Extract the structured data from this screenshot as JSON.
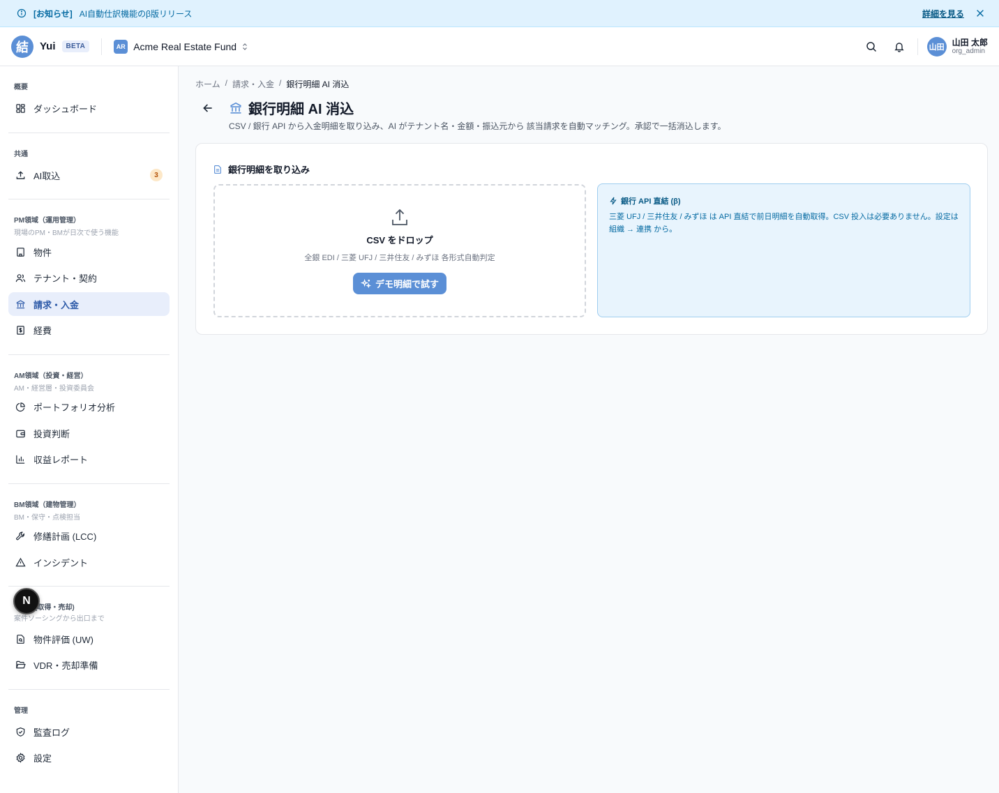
{
  "announcement": {
    "tag": "[お知らせ]",
    "message": "AI自動仕訳機能のβ版リリース",
    "link": "詳細を見る"
  },
  "header": {
    "logo_char": "結",
    "brand": "Yui",
    "beta": "BETA",
    "org_badge": "AR",
    "org_name": "Acme Real Estate Fund",
    "user_avatar": "山田",
    "user_name": "山田 太郎",
    "user_role": "org_admin"
  },
  "sidebar": {
    "overview": {
      "title": "概要",
      "items": [
        {
          "label": "ダッシュボード",
          "icon": "dashboard-icon"
        }
      ]
    },
    "common": {
      "title": "共通",
      "items": [
        {
          "label": "AI取込",
          "icon": "upload-icon",
          "badge": "3"
        }
      ]
    },
    "pm": {
      "title": "PM領域（運用管理）",
      "subtitle": "現場のPM・BMが日次で使う機能",
      "items": [
        {
          "label": "物件"
        },
        {
          "label": "テナント・契約"
        },
        {
          "label": "請求・入金"
        },
        {
          "label": "経費"
        }
      ]
    },
    "am": {
      "title": "AM領域（投資・経営）",
      "subtitle": "AM・経営層・投資委員会",
      "items": [
        {
          "label": "ポートフォリオ分析"
        },
        {
          "label": "投資判断"
        },
        {
          "label": "収益レポート"
        }
      ]
    },
    "bm": {
      "title": "BM領域（建物管理）",
      "subtitle": "BM・保守・点検担当",
      "items": [
        {
          "label": "修繕計画 (LCC)"
        },
        {
          "label": "インシデント"
        }
      ]
    },
    "deal": {
      "title": "(取得・売却)",
      "subtitle": "案件ソーシングから出口まで",
      "items": [
        {
          "label": "物件評価 (UW)"
        },
        {
          "label": "VDR・売却準備"
        }
      ]
    },
    "admin": {
      "title": "管理",
      "items": [
        {
          "label": "監査ログ"
        },
        {
          "label": "設定"
        }
      ]
    },
    "fab": "N"
  },
  "breadcrumb": {
    "home": "ホーム",
    "billing": "請求・入金",
    "current": "銀行明細 AI 消込"
  },
  "page": {
    "title": "銀行明細 AI 消込",
    "description": "CSV / 銀行 API から入金明細を取り込み、AI がテナント名・金額・振込元から 該当請求を自動マッチング。承認で一括消込します。"
  },
  "import_card": {
    "title": "銀行明細を取り込み",
    "drop_title": "CSV をドロップ",
    "drop_sub": "全銀 EDI / 三菱 UFJ / 三井住友 / みずほ 各形式自動判定",
    "demo_button": "デモ明細で試す",
    "api_title": "銀行 API 直結 (β)",
    "api_text": "三菱 UFJ / 三井住友 / みずほ は API 直結で前日明細を自動取得。CSV 投入は必要ありません。設定は 組織 → 連携 から。"
  },
  "colors": {
    "accent": "#5b8fd6",
    "active_bg": "#e8eefb",
    "info_bg": "#e0f2fe"
  }
}
